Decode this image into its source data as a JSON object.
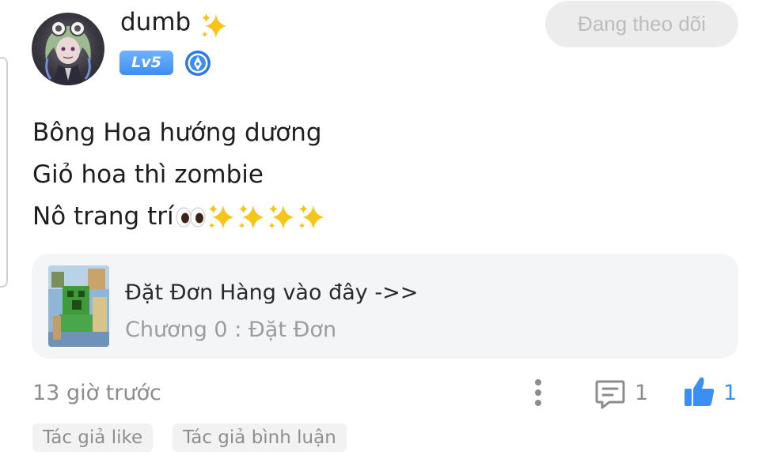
{
  "post": {
    "username": "dumb",
    "level_badge": "Lv5",
    "follow_button": "Đang theo dõi",
    "content_lines": [
      "Bông Hoa hướng dương",
      "Giỏ hoa thì zombie",
      "Nô trang trí"
    ],
    "content_trailing_emoji": [
      "eyes-emoji",
      "sparkles-emoji",
      "sparkles-emoji",
      "sparkles-emoji",
      "sparkles-emoji"
    ],
    "linked_story": {
      "title": "Đặt Đơn Hàng vào đây ->>",
      "chapter": "Chương 0 : Đặt Đơn"
    },
    "timestamp": "13 giờ trước",
    "comment_count": "1",
    "like_count": "1",
    "tags": [
      "Tác giả like",
      "Tác giả bình luận"
    ]
  },
  "icons": {
    "name_decoration": "sparkles-icon",
    "verify": "quill-badge-icon",
    "more": "more-vertical-icon",
    "comment": "comment-icon",
    "like": "thumbs-up-icon"
  },
  "colors": {
    "accent_blue": "#3b8ff3",
    "follow_button_bg": "#ececec",
    "card_bg": "#f4f5f7",
    "muted_text": "#8c8c8c",
    "sparkle_yellow": "#f5c518"
  }
}
